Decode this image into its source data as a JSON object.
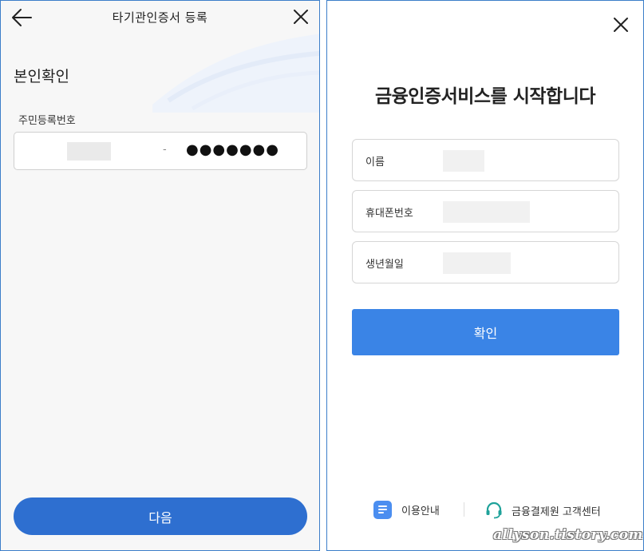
{
  "left_screen": {
    "title": "타기관인증서 등록",
    "heading": "본인확인",
    "rrn_label": "주민등록번호",
    "rrn_separator": "-",
    "rrn_masked": "●●●●●●●",
    "next_button": "다음",
    "icons": {
      "back": "arrow-left-icon",
      "close": "close-icon"
    },
    "accent_color": "#2e6fd0"
  },
  "right_screen": {
    "heading": "금융인증서비스를 시작합니다",
    "fields": [
      {
        "label": "이름"
      },
      {
        "label": "휴대폰번호"
      },
      {
        "label": "생년월일"
      }
    ],
    "confirm_button": "확인",
    "footer": {
      "guide": "이용안내",
      "customer_center": "금융결제원 고객센터"
    },
    "icons": {
      "close": "close-icon",
      "guide": "document-icon",
      "customer_center": "headset-icon"
    },
    "accent_color": "#3a84e6"
  },
  "watermark": "allyson.tistory.com"
}
